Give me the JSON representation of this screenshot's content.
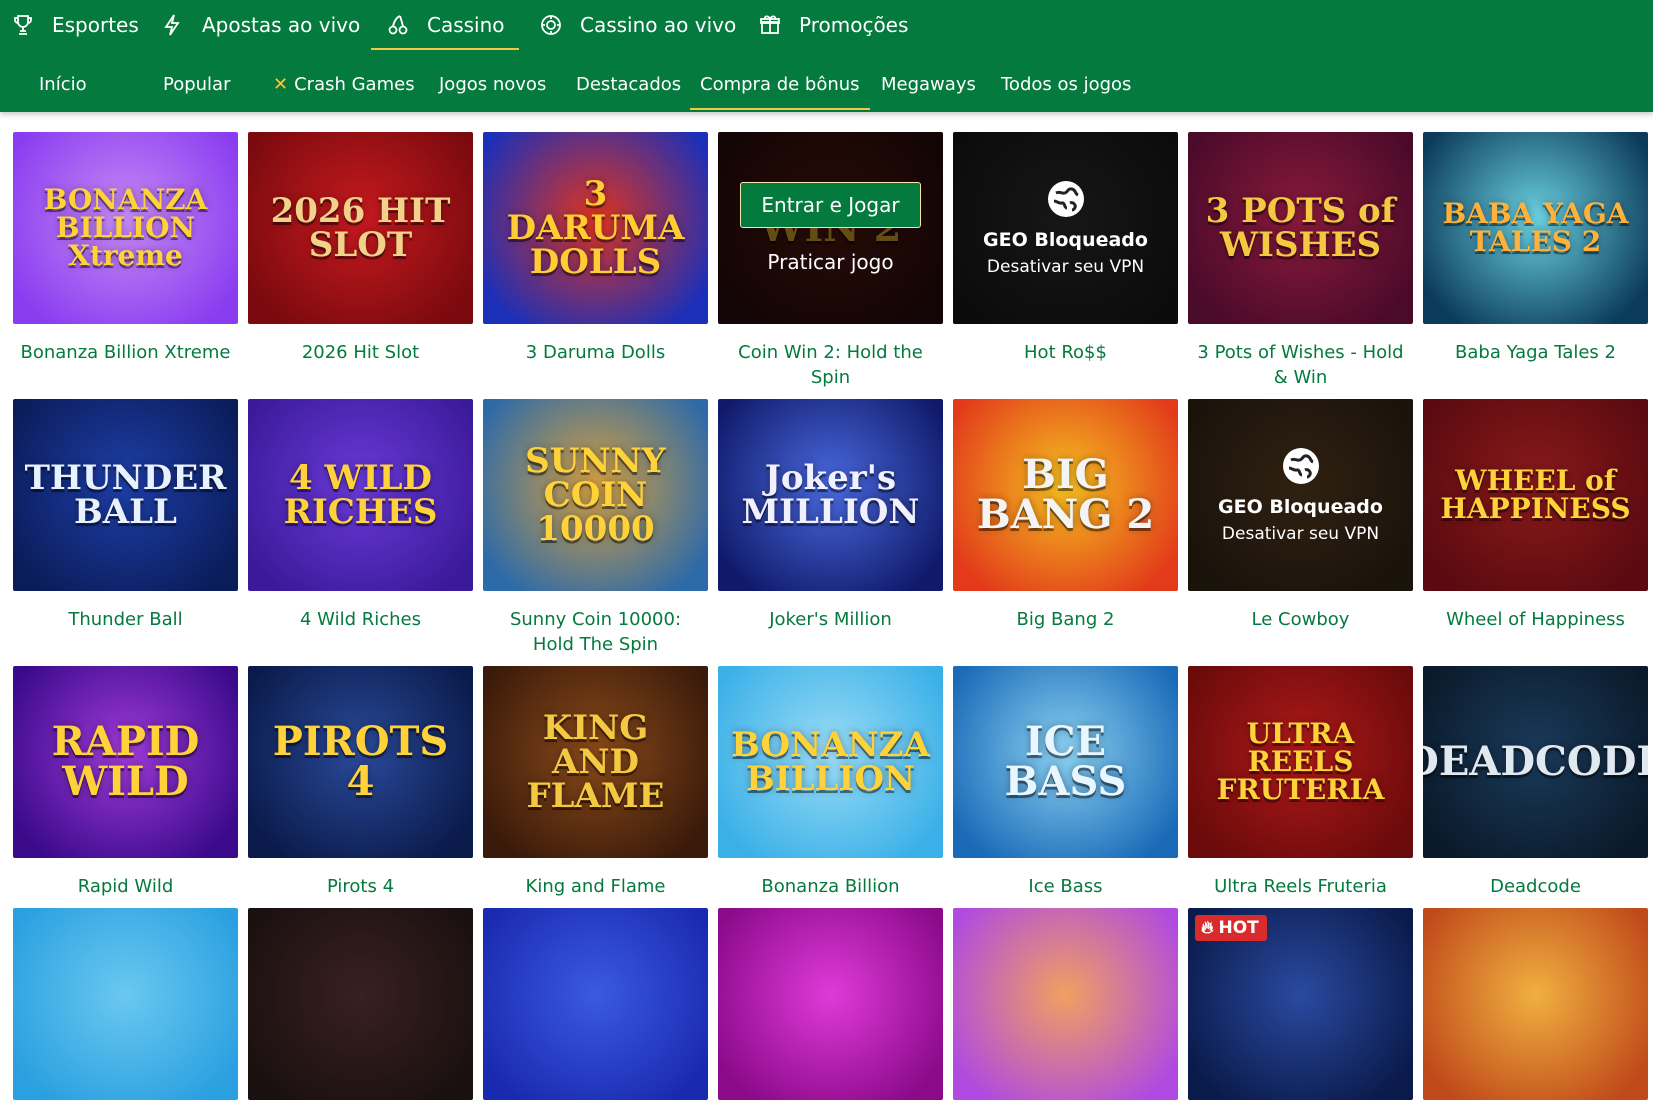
{
  "nav": {
    "main": [
      {
        "label": "Esportes",
        "icon": "trophy-icon"
      },
      {
        "label": "Apostas ao vivo",
        "icon": "lightning-icon"
      },
      {
        "label": "Cassino",
        "icon": "cherries-icon",
        "active": true
      },
      {
        "label": "Cassino ao vivo",
        "icon": "chip-icon"
      },
      {
        "label": "Promoções",
        "icon": "gift-icon"
      }
    ],
    "sub": [
      {
        "label": "Início"
      },
      {
        "label": "Popular"
      },
      {
        "label": "Crash Games",
        "icon": "crash-icon"
      },
      {
        "label": "Jogos novos"
      },
      {
        "label": "Destacados"
      },
      {
        "label": "Compra de bônus",
        "active": true
      },
      {
        "label": "Megaways"
      },
      {
        "label": "Todos os jogos"
      }
    ]
  },
  "overlays": {
    "play_label": "Entrar e Jogar",
    "demo_label": "Praticar jogo",
    "geo_title": "GEO Bloqueado",
    "geo_sub": "Desativar seu VPN",
    "hot_label": "HOT"
  },
  "games": [
    {
      "title": "Bonanza Billion Xtreme",
      "logo": "BONANZA BILLION Xtreme",
      "bg": [
        "#8a3df0",
        "#c78af5"
      ],
      "fg": "#ffd23a"
    },
    {
      "title": "2026 Hit Slot",
      "logo": "2026 HIT SLOT",
      "bg": [
        "#7a0a0e",
        "#c71a1f"
      ],
      "fg": "#f2d18a"
    },
    {
      "title": "3 Daruma Dolls",
      "logo": "3 DARUMA DOLLS",
      "bg": [
        "#1b2fb8",
        "#e0341e"
      ],
      "fg": "#ffcc33"
    },
    {
      "title": "Coin Win 2: Hold the Spin",
      "logo": "WIN 2",
      "bg": [
        "#2a0c0c",
        "#5a1a12"
      ],
      "fg": "#e0a830",
      "overlay": "play"
    },
    {
      "title": "Hot Ro$$",
      "logo": "",
      "bg": [
        "#1a1a1a",
        "#333333"
      ],
      "fg": "#ffffff",
      "overlay": "geo"
    },
    {
      "title": "3 Pots of Wishes - Hold & Win",
      "logo": "3 POTS of WISHES",
      "bg": [
        "#4a0a2a",
        "#8a1a3a"
      ],
      "fg": "#f5c842"
    },
    {
      "title": "Baba Yaga Tales 2",
      "logo": "BABA YAGA TALES 2",
      "bg": [
        "#0b3a5a",
        "#6ad0e0"
      ],
      "fg": "#ffb23a"
    },
    {
      "title": "Thunder Ball",
      "logo": "THUNDER BALL",
      "bg": [
        "#0b1c5a",
        "#1d3fa8"
      ],
      "fg": "#e8f2ff"
    },
    {
      "title": "4 Wild Riches",
      "logo": "4 WILD RICHES",
      "bg": [
        "#3b1a9a",
        "#6a3ad8"
      ],
      "fg": "#ffd23a"
    },
    {
      "title": "Sunny Coin 10000: Hold The Spin",
      "logo": "SUNNY COIN 10000",
      "bg": [
        "#2d6aa8",
        "#d6a040"
      ],
      "fg": "#ffd23a"
    },
    {
      "title": "Joker's Million",
      "logo": "Joker's MILLION",
      "bg": [
        "#101a6a",
        "#4a6ae0"
      ],
      "fg": "#f0f0ff"
    },
    {
      "title": "Big Bang 2",
      "logo": "BIG BANG 2",
      "bg": [
        "#e23a1a",
        "#f5c020"
      ],
      "fg": "#f4f4f4"
    },
    {
      "title": "Le Cowboy",
      "logo": "",
      "bg": [
        "#3a2a18",
        "#6a4a28"
      ],
      "fg": "#ffffff",
      "overlay": "geo"
    },
    {
      "title": "Wheel of Happiness",
      "logo": "WHEEL of HAPPINESS",
      "bg": [
        "#5a0a10",
        "#8a1a1a"
      ],
      "fg": "#ffd23a"
    },
    {
      "title": "Rapid Wild",
      "logo": "RAPID WILD",
      "bg": [
        "#3a0a8a",
        "#a03ad8"
      ],
      "fg": "#ffd23a"
    },
    {
      "title": "Pirots 4",
      "logo": "PIROTS 4",
      "bg": [
        "#0a1a4a",
        "#2a4a9a"
      ],
      "fg": "#ffd23a"
    },
    {
      "title": "King and Flame",
      "logo": "KING AND FLAME",
      "bg": [
        "#3a1a0a",
        "#8a4a1a"
      ],
      "fg": "#f5c842"
    },
    {
      "title": "Bonanza Billion",
      "logo": "BONANZA BILLION",
      "bg": [
        "#3ab0e8",
        "#9adcf5"
      ],
      "fg": "#ffd23a"
    },
    {
      "title": "Ice Bass",
      "logo": "ICE BASS",
      "bg": [
        "#1a6ab8",
        "#8ad0f0"
      ],
      "fg": "#e8f6ff"
    },
    {
      "title": "Ultra Reels Fruteria",
      "logo": "ULTRA REELS FRUTERIA",
      "bg": [
        "#6a0a0a",
        "#b01a1a"
      ],
      "fg": "#ffd23a"
    },
    {
      "title": "Deadcode",
      "logo": "DEADCODE",
      "bg": [
        "#0a1a2a",
        "#1a3a5a"
      ],
      "fg": "#e0e8f0"
    },
    {
      "title": "",
      "logo": "",
      "bg": [
        "#2aa0e0",
        "#6ac8f0"
      ],
      "fg": "#ffffff"
    },
    {
      "title": "",
      "logo": "",
      "bg": [
        "#1a1010",
        "#3a2020"
      ],
      "fg": "#ffffff"
    },
    {
      "title": "",
      "logo": "",
      "bg": [
        "#1a2ab0",
        "#3a5ae0"
      ],
      "fg": "#ffffff"
    },
    {
      "title": "",
      "logo": "",
      "bg": [
        "#8a0a8a",
        "#e03ad8"
      ],
      "fg": "#ffffff"
    },
    {
      "title": "",
      "logo": "",
      "bg": [
        "#b04ae0",
        "#f0a060"
      ],
      "fg": "#ffffff"
    },
    {
      "title": "",
      "logo": "",
      "bg": [
        "#0a1a4a",
        "#2a4aa0"
      ],
      "fg": "#ffffff",
      "overlay": "hot"
    },
    {
      "title": "",
      "logo": "",
      "bg": [
        "#c04a1a",
        "#f0b040"
      ],
      "fg": "#ffffff"
    }
  ]
}
